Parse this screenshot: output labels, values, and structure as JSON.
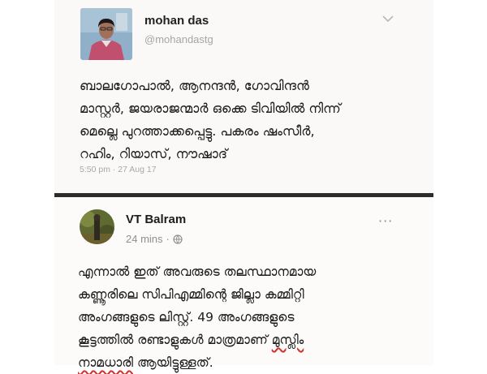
{
  "tweet": {
    "name": "mohan das",
    "handle": "@mohandastg",
    "lines": [
      "ബാലഗോപാൽ, ആനന്ദൻ, ഗോവിന്ദൻ",
      "മാസ്റ്റർ, ജയരാജന്മാർ ഒക്കെ ടിവിയിൽ നിന്ന്",
      "മെല്ലെ പുറത്താക്കപ്പെട്ടു. പകരം ഷംസീർ,",
      "റഹിം, റിയാസ്, നൗഷാദ്"
    ],
    "timestamp": "5:50 pm · 27 Aug 17",
    "menu_icon": "chevron-down-icon"
  },
  "post": {
    "name": "VT Balram",
    "time": "24 mins",
    "separator": "·",
    "privacy_icon": "globe-icon",
    "menu_label": "···",
    "lines": [
      "എന്നാൽ ഇത് അവരുടെ തലസ്ഥാനമായ",
      "കണ്ണൂരിലെ സിപിഎമ്മിന്റെ ജില്ലാ കമ്മിറ്റി",
      "അംഗങ്ങളുടെ ലിസ്റ്റ്. 49 അംഗങ്ങളുടെ"
    ],
    "line4_plain": "കൂട്ടത്തിൽ രണ്ടാളുകൾ മാത്രമാണ് ",
    "line4_marked": "മുസ്ലിം",
    "line5_marked": "നാമധാരി",
    "line5_plain": " ആയിട്ടുള്ളത്.",
    "underline_color": "#d0312d"
  },
  "colors": {
    "card_bg": "#fbf9f8",
    "divider": "#2c2c2c",
    "muted_text": "#a8a8a8"
  }
}
